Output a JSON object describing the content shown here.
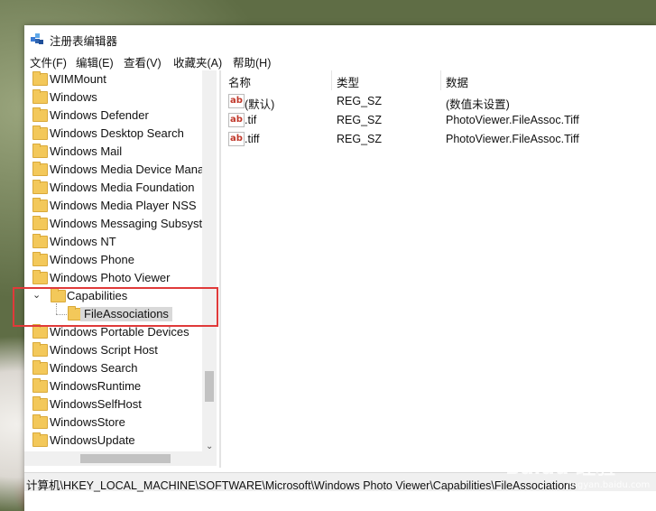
{
  "window": {
    "title": "注册表编辑器",
    "menu": [
      "文件(F)",
      "编辑(E)",
      "查看(V)",
      "收藏夹(A)",
      "帮助(H)"
    ]
  },
  "tree": {
    "items": [
      {
        "label": "WIMMount",
        "level": 1
      },
      {
        "label": "Windows",
        "level": 1
      },
      {
        "label": "Windows Defender",
        "level": 1
      },
      {
        "label": "Windows Desktop Search",
        "level": 1
      },
      {
        "label": "Windows Mail",
        "level": 1
      },
      {
        "label": "Windows Media Device Mana",
        "level": 1
      },
      {
        "label": "Windows Media Foundation",
        "level": 1
      },
      {
        "label": "Windows Media Player NSS",
        "level": 1
      },
      {
        "label": "Windows Messaging Subsyst",
        "level": 1
      },
      {
        "label": "Windows NT",
        "level": 1
      },
      {
        "label": "Windows Phone",
        "level": 1
      },
      {
        "label": "Windows Photo Viewer",
        "level": 1
      },
      {
        "label": "Capabilities",
        "level": 2,
        "expanded": true
      },
      {
        "label": "FileAssociations",
        "level": 3,
        "selected": true
      },
      {
        "label": "Windows Portable Devices",
        "level": 1
      },
      {
        "label": "Windows Script Host",
        "level": 1
      },
      {
        "label": "Windows Search",
        "level": 1
      },
      {
        "label": "WindowsRuntime",
        "level": 1
      },
      {
        "label": "WindowsSelfHost",
        "level": 1
      },
      {
        "label": "WindowsStore",
        "level": 1
      },
      {
        "label": "WindowsUpdate",
        "level": 1
      }
    ]
  },
  "values": {
    "columns": [
      "名称",
      "类型",
      "数据"
    ],
    "rows": [
      {
        "name": "(默认)",
        "type": "REG_SZ",
        "data": "(数值未设置)"
      },
      {
        "name": ".tif",
        "type": "REG_SZ",
        "data": "PhotoViewer.FileAssoc.Tiff"
      },
      {
        "name": ".tiff",
        "type": "REG_SZ",
        "data": "PhotoViewer.FileAssoc.Tiff"
      }
    ]
  },
  "status": {
    "path": "计算机\\HKEY_LOCAL_MACHINE\\SOFTWARE\\Microsoft\\Windows Photo Viewer\\Capabilities\\FileAssociations"
  },
  "watermark": {
    "text": "Baidu 经验",
    "sub": "jingyan.baidu.com"
  },
  "colors": {
    "highlight": "#e03a3a",
    "folder": "#f3c85a",
    "selection": "#d9d9d9"
  }
}
